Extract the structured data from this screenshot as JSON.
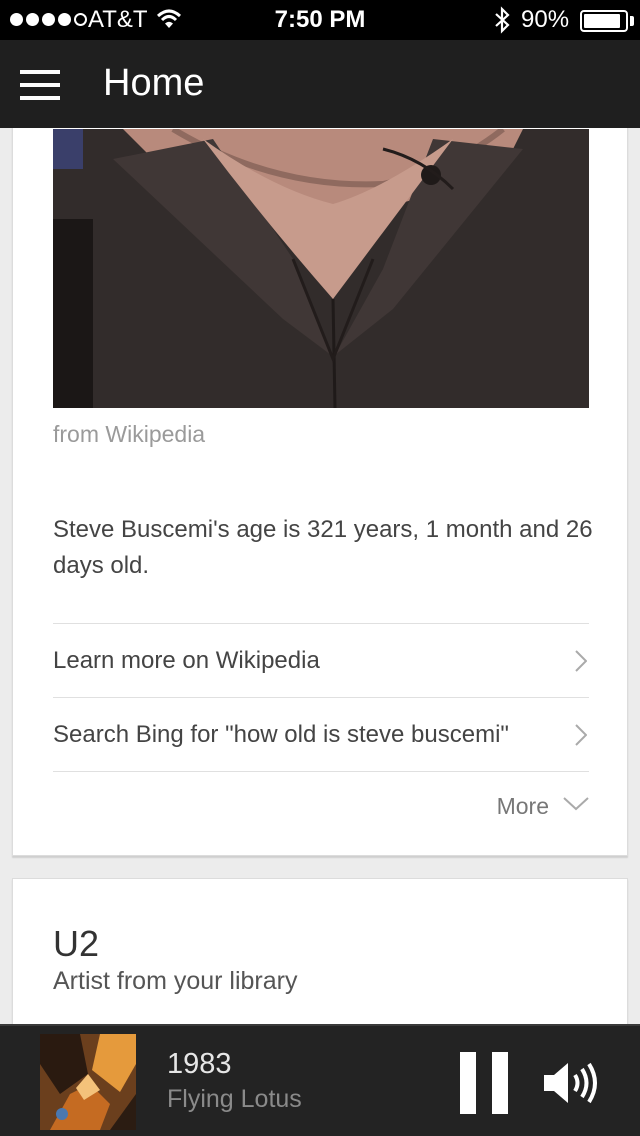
{
  "status_bar": {
    "carrier": "AT&T",
    "time": "7:50 PM",
    "battery_percent": "90%",
    "battery_level": 0.9,
    "signal_bars_filled": 4,
    "signal_bars_total": 5
  },
  "header": {
    "title": "Home",
    "menu_icon": "hamburger-menu-icon"
  },
  "answer_card": {
    "source": "from Wikipedia",
    "answer": "Steve Buscemi's age is 321 years, 1 month and 26 days old.",
    "links": [
      {
        "label": "Learn more on Wikipedia"
      },
      {
        "label": "Search Bing for \"how old is steve buscemi\""
      }
    ],
    "more_label": "More"
  },
  "artist_card": {
    "name": "U2",
    "subtitle": "Artist from your library"
  },
  "player": {
    "track_title": "1983",
    "track_artist": "Flying Lotus",
    "pause_icon": "pause-icon",
    "volume_icon": "volume-icon"
  },
  "colors": {
    "header_bg": "#1f1f1f",
    "status_bg": "#000000",
    "page_bg": "#ececec",
    "card_bg": "#ffffff",
    "player_bg": "#232323",
    "secondary_text": "#9a9a9a"
  }
}
